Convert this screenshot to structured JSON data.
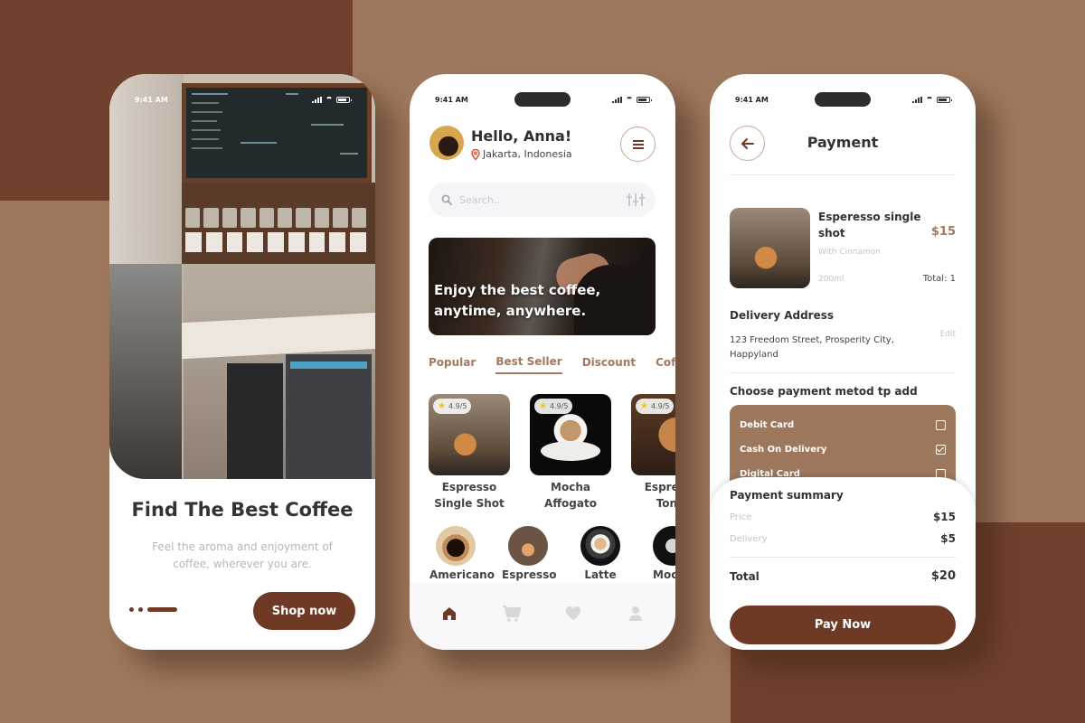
{
  "colors": {
    "background": "#9e785d",
    "accent_dark": "#70412d",
    "button": "#6e3a26",
    "accent_tan": "#a4795f",
    "pin_red": "#e0483a",
    "star": "#f4c21a"
  },
  "status_bar": {
    "time": "9:41 AM"
  },
  "onboarding": {
    "title": "Find The Best Coffee",
    "subtitle": "Feel the aroma and enjoyment of coffee, wherever you are.",
    "cta_label": "Shop now",
    "pager": {
      "total": 3,
      "active": 3
    }
  },
  "home": {
    "greeting": "Hello, Anna!",
    "location": "Jakarta, Indonesia",
    "search": {
      "placeholder": "Search.."
    },
    "banner_text": "Enjoy the best coffee, anytime, anywhere.",
    "tabs": [
      {
        "label": "Popular",
        "active": false
      },
      {
        "label": "Best Seller",
        "active": true
      },
      {
        "label": "Discount",
        "active": false
      },
      {
        "label": "Coffee",
        "active": false
      }
    ],
    "products": [
      {
        "name": "Espresso Single Shot",
        "rating": "4.9/5"
      },
      {
        "name": "Mocha Affogato",
        "rating": "4.9/5"
      },
      {
        "name": "Espresso Tonic",
        "rating": "4.9/5"
      }
    ],
    "categories": [
      {
        "label": "Americano"
      },
      {
        "label": "Espresso"
      },
      {
        "label": "Latte"
      },
      {
        "label": "Mocha"
      }
    ],
    "nav": [
      {
        "icon": "home-icon",
        "active": true
      },
      {
        "icon": "cart-icon",
        "active": false
      },
      {
        "icon": "heart-icon",
        "active": false
      },
      {
        "icon": "profile-icon",
        "active": false
      }
    ]
  },
  "payment": {
    "title": "Payment",
    "item": {
      "name": "Esperesso single shot",
      "price": "$15",
      "note": "With Cinnamon",
      "size": "200ml",
      "quantity": "Total: 1"
    },
    "address": {
      "title": "Delivery Address",
      "text": "123 Freedom Street, Prosperity City, Happyland",
      "edit_label": "Edit"
    },
    "methods_title": "Choose payment metod tp add",
    "methods": [
      {
        "label": "Debit Card",
        "checked": false
      },
      {
        "label": "Cash On Delivery",
        "checked": true
      },
      {
        "label": "Digital Card",
        "checked": false
      }
    ],
    "summary": {
      "title": "Payment summary",
      "price_label": "Price",
      "price_value": "$15",
      "delivery_label": "Delivery",
      "delivery_value": "$5",
      "total_label": "Total",
      "total_value": "$20"
    },
    "pay_label": "Pay Now"
  }
}
